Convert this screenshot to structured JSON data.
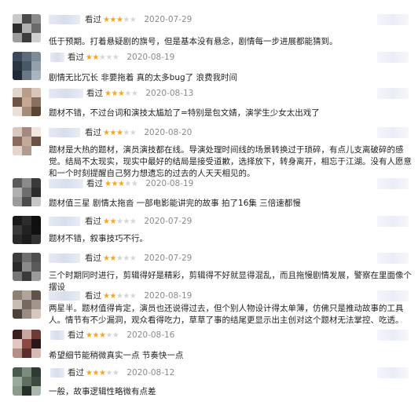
{
  "reviews": [
    {
      "seen": "看过",
      "rating": 3,
      "date": "2020-07-29",
      "comment": "低于预期。打着悬疑剧的旗号，但是基本没有悬念，剧情每一步进展都能猜到。"
    },
    {
      "seen": "看过",
      "rating": 2,
      "date": "2020-08-19",
      "comment": "剧情无比冗长 非要拖着 真的太多bug了 浪费我时间"
    },
    {
      "seen": "看过",
      "rating": 3,
      "date": "2020-08-13",
      "comment": "题材不错，不过台词和演技太尴尬了=特别是包文婧，演学生少女太出戏了"
    },
    {
      "seen": "看过",
      "rating": 3,
      "date": "2020-08-20",
      "comment": "题材是大热的题材，演员演技都在线。导演处理时间线的场景转换过于琐碎，有点儿支离破碎的感觉。结局不太现实，现实中最好的结局是接受道歉，选择放下，转身离开，相忘于江湖。没有人愿意和一个时刻提醒自己努力想遗忘的过去的人天天相见的。"
    },
    {
      "seen": "看过",
      "rating": 3,
      "date": "2020-08-19",
      "comment": "题材值三星 剧情太拖沓 一部电影能讲完的故事 拍了16集 三倍速都慢"
    },
    {
      "seen": "看过",
      "rating": 2,
      "date": "2020-07-29",
      "comment": "题材不错，叙事技巧不行。"
    },
    {
      "seen": "看过",
      "rating": 2,
      "date": "2020-07-29",
      "comment": "三个时期同时进行，剪辑得好是精彩，剪辑得不好就显得混乱，而且拖慢剧情发展，警察在里面像个摆设"
    },
    {
      "seen": "看过",
      "rating": 2,
      "date": "2020-08-19",
      "comment": "两星半。题材值得肯定，演员也还说得过去，但个别人物设计得太单薄，仿佛只是推动故事的工具人。情节有不少漏洞，观众看得吃力，草草了事的结尾更显示出主创对这个题材无法掌控、吃透。"
    },
    {
      "seen": "看过",
      "rating": 3,
      "date": "2020-08-16",
      "comment": "希望细节能稍微真实一点 节奏快一点"
    },
    {
      "seen": "看过",
      "rating": 3,
      "date": "2020-08-12",
      "comment": "一般，故事逻辑性略微有点差"
    }
  ]
}
